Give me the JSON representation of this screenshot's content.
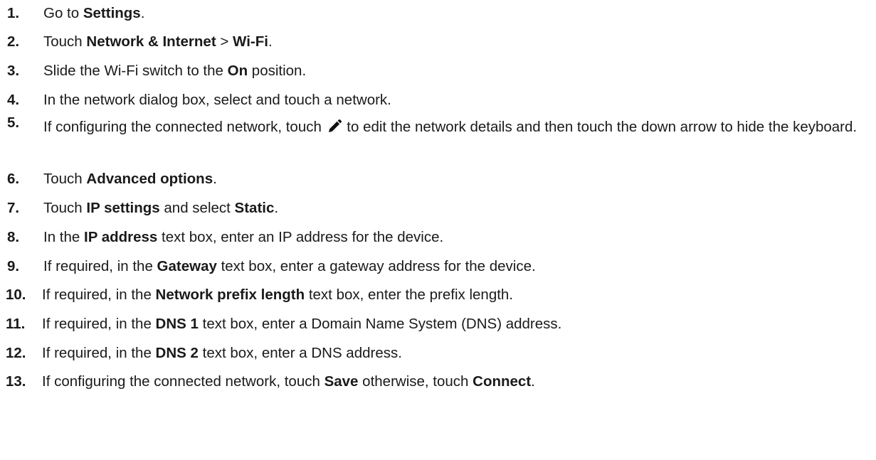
{
  "steps": [
    {
      "num": "1.",
      "parts": [
        "Go to ",
        "Settings",
        "."
      ]
    },
    {
      "num": "2.",
      "parts": [
        "Touch ",
        "Network & Internet",
        " > ",
        "Wi-Fi",
        "."
      ]
    },
    {
      "num": "3.",
      "parts": [
        "Slide the Wi-Fi switch to the ",
        "On",
        " position."
      ]
    },
    {
      "num": "4.",
      "parts": [
        "In the network dialog box, select and touch a network."
      ]
    },
    {
      "num": "5.",
      "parts": [
        "If configuring the connected network, touch ",
        " to edit the network details and then touch the down arrow to hide the keyboard."
      ],
      "icon": "pencil-icon"
    },
    {
      "num": "6.",
      "parts": [
        "Touch ",
        "Advanced options",
        "."
      ]
    },
    {
      "num": "7.",
      "parts": [
        "Touch ",
        "IP settings",
        " and select ",
        "Static",
        "."
      ]
    },
    {
      "num": "8.",
      "parts": [
        "In the ",
        "IP address",
        " text box, enter an IP address for the device."
      ]
    },
    {
      "num": "9.",
      "parts": [
        "If required, in the ",
        "Gateway",
        " text box, enter a gateway address for the device."
      ]
    },
    {
      "num": "10.",
      "parts": [
        "If required, in the ",
        "Network prefix length",
        " text box, enter the prefix length."
      ]
    },
    {
      "num": "11.",
      "parts": [
        "If required, in the ",
        "DNS 1",
        " text box, enter a Domain Name System (DNS) address."
      ]
    },
    {
      "num": "12.",
      "parts": [
        "If required, in the ",
        "DNS 2",
        " text box, enter a DNS address."
      ]
    },
    {
      "num": "13.",
      "parts": [
        "If configuring the connected network, touch ",
        "Save",
        " otherwise, touch ",
        "Connect",
        "."
      ]
    }
  ]
}
